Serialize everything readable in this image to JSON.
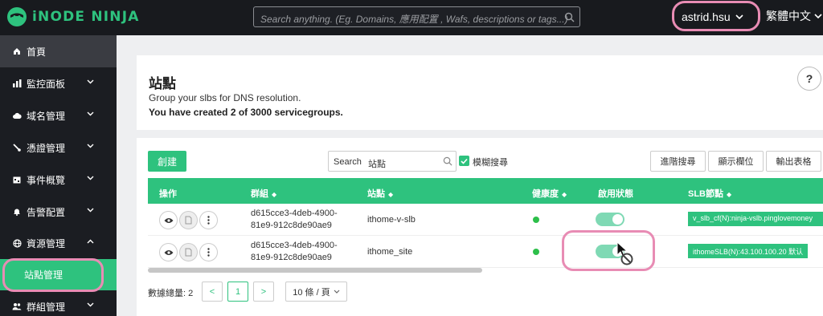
{
  "header": {
    "logo_text": "iNODE NINJA",
    "search_placeholder": "Search anything. (Eg. Domains, 應用配置 , Wafs, descriptions or tags...)",
    "user": "astrid.hsu",
    "language": "繁體中文"
  },
  "sidebar": {
    "items": [
      {
        "label": "首頁",
        "icon": "home-icon"
      },
      {
        "label": "監控面板",
        "icon": "bar-chart-icon"
      },
      {
        "label": "域名管理",
        "icon": "cloud-icon"
      },
      {
        "label": "憑證管理",
        "icon": "brush-icon"
      },
      {
        "label": "事件概覽",
        "icon": "calendar-icon"
      },
      {
        "label": "告警配置",
        "icon": "bell-icon"
      },
      {
        "label": "資源管理",
        "icon": "globe-icon"
      }
    ],
    "sub_item": "站點管理",
    "bottom_item": {
      "label": "群組管理",
      "icon": "users-icon"
    }
  },
  "page": {
    "title": "站點",
    "description": "Group your slbs for DNS resolution.",
    "count_text": "You have created 2 of 3000 servicegroups.",
    "help": "?"
  },
  "toolbar": {
    "create": "創建",
    "search_label": "Search",
    "search_value": "站點",
    "fuzzy_label": "模糊搜尋",
    "fuzzy_checked": true,
    "advanced": "進階搜尋",
    "columns": "顯示欄位",
    "export": "輸出表格"
  },
  "table": {
    "headers": {
      "actions": "操作",
      "group": "群組",
      "site": "站點",
      "health": "健康度",
      "status": "啟用狀態",
      "slb": "SLB節點"
    },
    "rows": [
      {
        "group_line1": "d615cce3-4deb-4900-",
        "group_line2": "81e9-912c8de90ae9",
        "site": "ithome-v-slb",
        "healthy": true,
        "enabled": true,
        "slb": "v_slb_cf(N):ninja-vslb.pinglovemoney"
      },
      {
        "group_line1": "d615cce3-4deb-4900-",
        "group_line2": "81e9-912c8de90ae9",
        "site": "ithome_site",
        "healthy": true,
        "enabled": true,
        "slb": "ithomeSLB(N):43.100.100.20 默认"
      }
    ]
  },
  "pagination": {
    "total": "數據總量: 2",
    "prev": "<",
    "current": "1",
    "next": ">",
    "page_size": "10 條 / 頁"
  },
  "colors": {
    "accent": "#2ec27e",
    "highlight": "#e88cb4",
    "topbar": "#181a1e",
    "sidebar": "#1b1d22"
  }
}
